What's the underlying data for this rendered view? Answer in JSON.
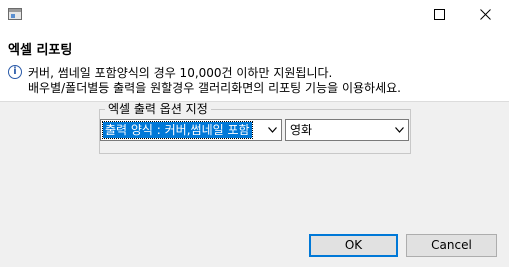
{
  "window": {
    "icon": "app-window-icon",
    "controls": [
      "maximize-icon",
      "close-icon"
    ]
  },
  "header": {
    "title": "엑셀 리포팅",
    "info_icon_glyph": "i",
    "info_lines": [
      "커버, 썸네일 포함양식의 경우 10,000건 이하만 지원됩니다.",
      "배우별/폴더별등 출력을 원할경우 갤러리화면의 리포팅 기능을 이용하세요."
    ]
  },
  "options": {
    "group_label": "엑셀 출력 옵션 지정",
    "format_selected": "출력 양식 : 커버,썸네일 포함",
    "genre_selected": "영화"
  },
  "buttons": {
    "ok": "OK",
    "cancel": "Cancel"
  },
  "colors": {
    "accent": "#0078d7",
    "info_icon": "#2a5aa8",
    "dialog_bg": "#f0f0f0",
    "header_bg": "#ffffff"
  }
}
